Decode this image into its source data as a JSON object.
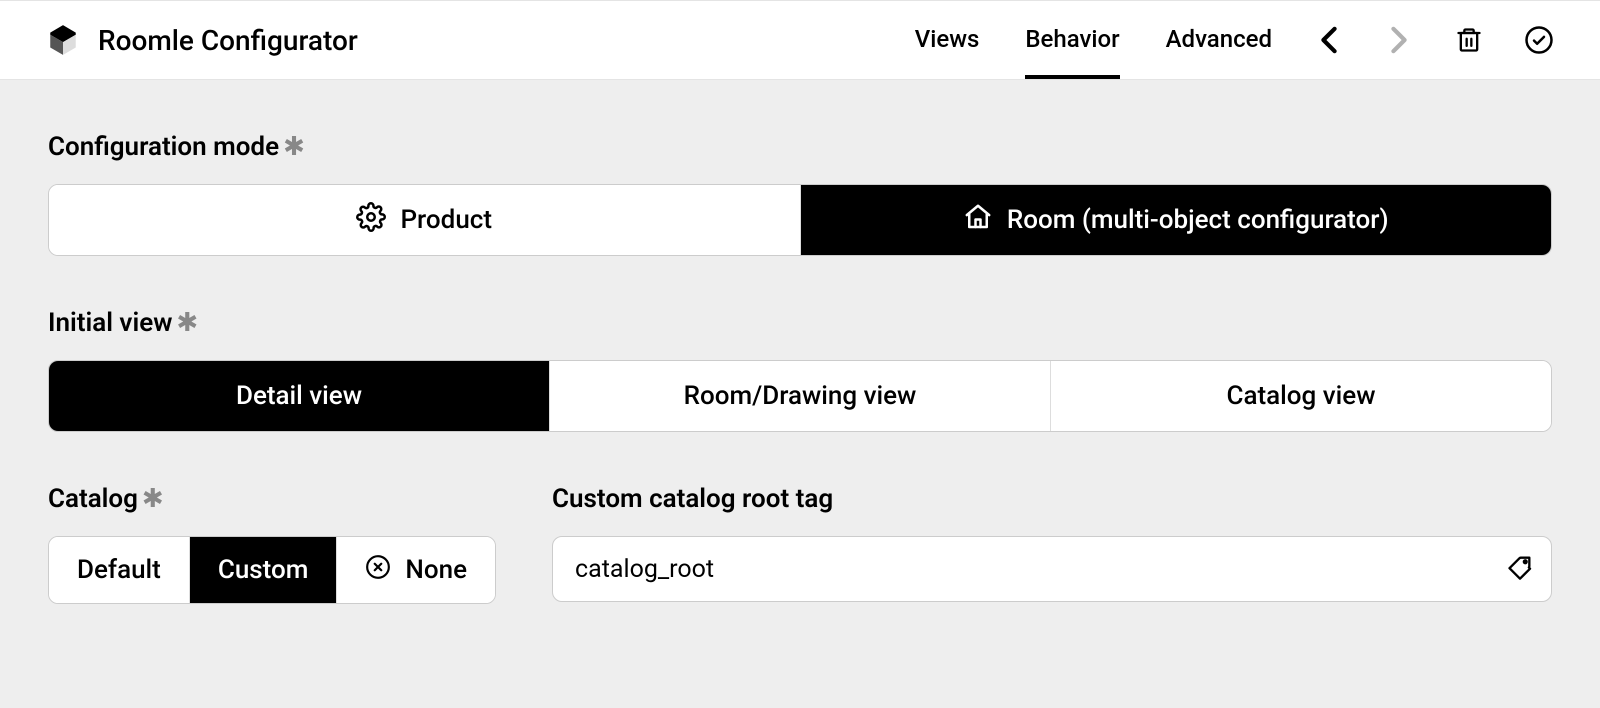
{
  "header": {
    "title": "Roomle Configurator",
    "tabs": [
      {
        "label": "Views",
        "active": false
      },
      {
        "label": "Behavior",
        "active": true
      },
      {
        "label": "Advanced",
        "active": false
      }
    ]
  },
  "sections": {
    "config_mode": {
      "label": "Configuration mode",
      "required": true,
      "options": [
        {
          "label": "Product",
          "icon": "gear",
          "selected": false
        },
        {
          "label": "Room (multi-object configurator)",
          "icon": "home",
          "selected": true
        }
      ]
    },
    "initial_view": {
      "label": "Initial view",
      "required": true,
      "options": [
        {
          "label": "Detail view",
          "selected": true
        },
        {
          "label": "Room/Drawing view",
          "selected": false
        },
        {
          "label": "Catalog view",
          "selected": false
        }
      ]
    },
    "catalog": {
      "label": "Catalog",
      "required": true,
      "options": [
        {
          "label": "Default",
          "selected": false
        },
        {
          "label": "Custom",
          "selected": true
        },
        {
          "label": "None",
          "icon": "x-circle",
          "selected": false
        }
      ]
    },
    "custom_tag": {
      "label": "Custom catalog root tag",
      "value": "catalog_root"
    }
  }
}
